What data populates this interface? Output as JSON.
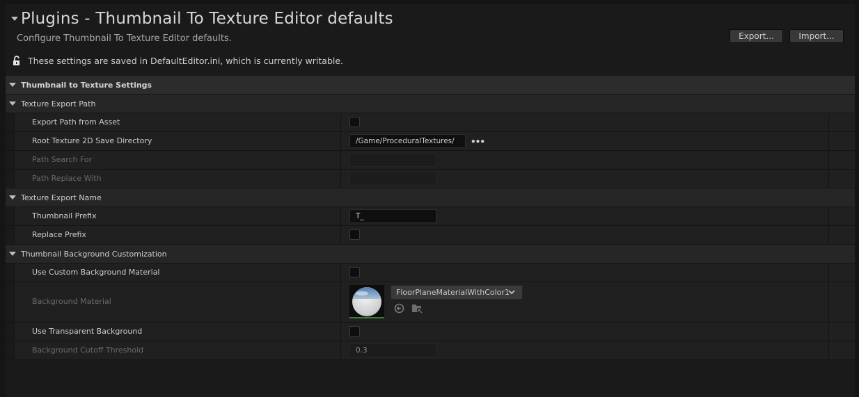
{
  "header": {
    "title": "Plugins - Thumbnail To Texture Editor defaults",
    "subtitle": "Configure Thumbnail To Texture Editor defaults.",
    "export_label": "Export...",
    "import_label": "Import...",
    "writable_text": "These settings are saved in DefaultEditor.ini, which is currently writable."
  },
  "category": {
    "label": "Thumbnail to Texture Settings"
  },
  "sections": {
    "export_path": {
      "label": "Texture Export Path",
      "export_path_from_asset": {
        "label": "Export Path from Asset",
        "checked": false
      },
      "root_dir": {
        "label": "Root Texture 2D Save Directory",
        "value": "/Game/ProceduralTextures/"
      },
      "path_search": {
        "label": "Path Search For",
        "value": ""
      },
      "path_replace": {
        "label": "Path Replace With",
        "value": ""
      }
    },
    "export_name": {
      "label": "Texture Export Name",
      "thumbnail_prefix": {
        "label": "Thumbnail Prefix",
        "value": "T_"
      },
      "replace_prefix": {
        "label": "Replace Prefix",
        "checked": false
      }
    },
    "background": {
      "label": "Thumbnail Background Customization",
      "use_custom_material": {
        "label": "Use Custom Background Material",
        "checked": false
      },
      "background_material": {
        "label": "Background Material",
        "asset": "FloorPlaneMaterialWithColor1"
      },
      "use_transparent": {
        "label": "Use Transparent Background",
        "checked": false
      },
      "cutoff": {
        "label": "Background Cutoff Threshold",
        "value": "0.3"
      }
    }
  },
  "colors": {
    "panel": "#1a1a1a",
    "row": "#202020",
    "category": "#2c2c2c",
    "thumbnail_accent": "#3b7a3b"
  },
  "icons": [
    "lock-open-icon",
    "collapse-arrow-icon",
    "ellipsis-icon",
    "chevron-down-icon",
    "reset-arrow-icon",
    "browse-folder-icon"
  ]
}
